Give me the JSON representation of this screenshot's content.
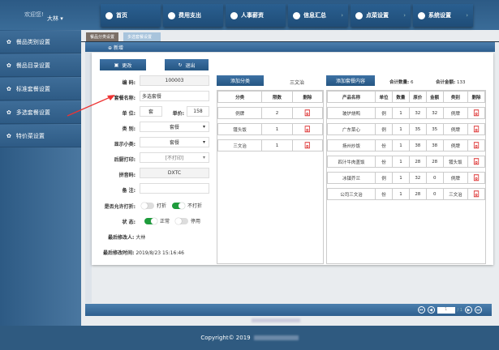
{
  "header": {
    "welcome": "欢迎您!",
    "user": "大林 ▾",
    "nav": [
      {
        "label": "首页",
        "chev": false
      },
      {
        "label": "费用支出",
        "chev": false
      },
      {
        "label": "人事薪资",
        "chev": false
      },
      {
        "label": "信息汇总",
        "chev": true
      },
      {
        "label": "点菜设置",
        "chev": true
      },
      {
        "label": "系统设置",
        "chev": true
      }
    ]
  },
  "sidebar": [
    "餐品类别设置",
    "餐品目录设置",
    "标准套餐设置",
    "多选套餐设置",
    "特价菜设置"
  ],
  "tabs": [
    "餐品分类设置",
    "多选套餐设置"
  ],
  "section_title": "新增",
  "buttons": {
    "update": "更改",
    "exit": "退出",
    "add_category": "添加分类",
    "add_content": "添加套餐内容"
  },
  "form": {
    "code_label": "编  码:",
    "code": "100003",
    "name_label": "套餐名称:",
    "name": "多选套餐",
    "unit_label": "单  位:",
    "unit": "套",
    "price_label": "单价:",
    "price": "158",
    "category_label": "类  别:",
    "category": "套餐",
    "subcat_label": "显示小类:",
    "subcat": "套餐",
    "kitchen_label": "后厨打印:",
    "kitchen": "[不打印]",
    "pinyin_label": "拼音码:",
    "pinyin": "DXTC",
    "note_label": "备  注:",
    "note": "",
    "discount_label": "是否允许打折:",
    "discount_yes": "打折",
    "discount_no": "不打折",
    "status_label": "状  态:",
    "status_normal": "正常",
    "status_disabled": "停用",
    "modifier_label": "最后修改人:",
    "modifier": "大林",
    "modtime_label": "最后修改时间:",
    "modtime": "2019/8/23 15:16:46"
  },
  "category_table": {
    "selected": "三文治",
    "headers": [
      "分类",
      "限数",
      "删除"
    ],
    "rows": [
      [
        "例牌",
        "2"
      ],
      [
        "镬头饭",
        "1"
      ],
      [
        "三文治",
        "1"
      ]
    ]
  },
  "product_table": {
    "total_qty_label": "合计数量:",
    "total_qty": "6",
    "total_amt_label": "合计金额:",
    "total_amt": "133",
    "headers": [
      "产品名称",
      "单位",
      "数量",
      "原价",
      "金额",
      "类别",
      "删除"
    ],
    "rows": [
      [
        "玻炉烧鸭",
        "例",
        "1",
        "32",
        "32",
        "例牌"
      ],
      [
        "广东菜心",
        "例",
        "1",
        "35",
        "35",
        "例牌"
      ],
      [
        "扬州炒饭",
        "份",
        "1",
        "38",
        "38",
        "例牌"
      ],
      [
        "四汁牛肉盖饭",
        "份",
        "1",
        "28",
        "28",
        "镬头饭"
      ],
      [
        "冰镇芥兰",
        "例",
        "1",
        "32",
        "0",
        "例牌"
      ],
      [
        "公司三文治",
        "份",
        "1",
        "28",
        "0",
        "三文治"
      ]
    ]
  },
  "pager": {
    "page": "1",
    "total": "/ 1"
  },
  "footer": {
    "copyright": "Copyright© 2019"
  },
  "colors": {
    "accent": "#2e5f8f",
    "toggle_on": "#1e9c3c",
    "delete": "#d33333"
  }
}
